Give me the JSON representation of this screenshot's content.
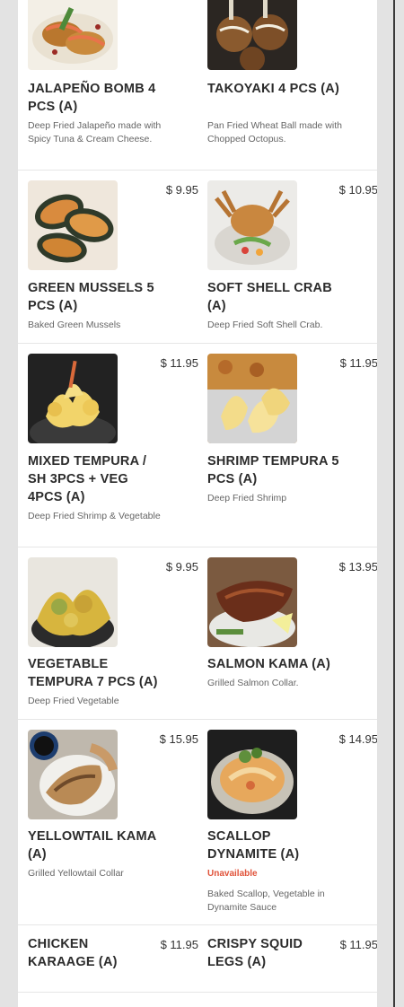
{
  "menu": {
    "items": [
      {
        "name": "JALAPEÑO BOMB 4 PCS (A)",
        "price": "",
        "description": "Deep Fried Jalapeño made with Spicy Tuna & Cream Cheese.",
        "status": "",
        "image": "jalapeno-bomb-photo"
      },
      {
        "name": "TAKOYAKI 4 PCS (A)",
        "price": "",
        "description": "Pan Fried Wheat Ball made with Chopped Octopus.",
        "status": "",
        "image": "takoyaki-photo"
      },
      {
        "name": "GREEN MUSSELS 5 PCS (A)",
        "price": "$ 9.95",
        "description": "Baked Green Mussels",
        "status": "",
        "image": "green-mussels-photo"
      },
      {
        "name": "SOFT SHELL CRAB (A)",
        "price": "$ 10.95",
        "description": "Deep Fried Soft Shell Crab.",
        "status": "",
        "image": "soft-shell-crab-photo"
      },
      {
        "name": "MIXED TEMPURA / SH 3PCS + VEG 4PCS (A)",
        "price": "$ 11.95",
        "description": "Deep Fried Shrimp & Vegetable",
        "status": "",
        "image": "mixed-tempura-photo"
      },
      {
        "name": "SHRIMP TEMPURA 5 PCS (A)",
        "price": "$ 11.95",
        "description": "Deep Fried Shrimp",
        "status": "",
        "image": "shrimp-tempura-photo"
      },
      {
        "name": "VEGETABLE TEMPURA 7 PCS (A)",
        "price": "$ 9.95",
        "description": "Deep Fried Vegetable",
        "status": "",
        "image": "vegetable-tempura-photo"
      },
      {
        "name": "SALMON KAMA (A)",
        "price": "$ 13.95",
        "description": "Grilled Salmon Collar.",
        "status": "",
        "image": "salmon-kama-photo"
      },
      {
        "name": "YELLOWTAIL KAMA (A)",
        "price": "$ 15.95",
        "description": "Grilled Yellowtail Collar",
        "status": "",
        "image": "yellowtail-kama-photo"
      },
      {
        "name": "SCALLOP DYNAMITE (A)",
        "price": "$ 14.95",
        "description": "Baked Scallop, Vegetable in Dynamite Sauce",
        "status": "Unavailable",
        "image": "scallop-dynamite-photo"
      },
      {
        "name": "CHICKEN KARAAGE (A)",
        "price": "$ 11.95",
        "description": "",
        "status": "",
        "image": ""
      },
      {
        "name": "CRISPY SQUID LEGS (A)",
        "price": "$ 11.95",
        "description": "",
        "status": "",
        "image": ""
      }
    ]
  },
  "colors": {
    "background": "#e3e3e3",
    "card": "#ffffff",
    "unavailable": "#e0533a"
  }
}
